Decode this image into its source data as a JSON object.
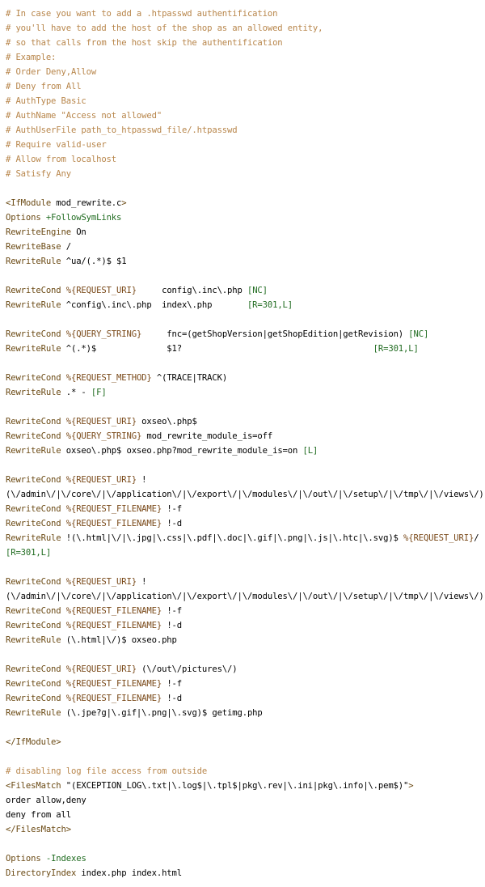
{
  "colors": {
    "comment": "#b8864b",
    "directive": "#6b4a14",
    "option": "#1f6b1f",
    "variable": "#7a4a1a",
    "text": "#000000",
    "background": "#ffffff"
  },
  "lines": [
    [
      [
        "c",
        "# In case you want to add a .htpasswd authentification"
      ]
    ],
    [
      [
        "c",
        "# you'll have to add the host of the shop as an allowed entity,"
      ]
    ],
    [
      [
        "c",
        "# so that calls from the host skip the authentification"
      ]
    ],
    [
      [
        "c",
        "# Example:"
      ]
    ],
    [
      [
        "c",
        "# Order Deny,Allow"
      ]
    ],
    [
      [
        "c",
        "# Deny from All"
      ]
    ],
    [
      [
        "c",
        "# AuthType Basic"
      ]
    ],
    [
      [
        "c",
        "# AuthName \"Access not allowed\""
      ]
    ],
    [
      [
        "c",
        "# AuthUserFile path_to_htpasswd_file/.htpasswd"
      ]
    ],
    [
      [
        "c",
        "# Require valid-user"
      ]
    ],
    [
      [
        "c",
        "# Allow from localhost"
      ]
    ],
    [
      [
        "c",
        "# Satisfy Any"
      ]
    ],
    [],
    [
      [
        "t",
        "<IfModule"
      ],
      [
        "p",
        " mod_rewrite.c"
      ],
      [
        "t",
        ">"
      ]
    ],
    [
      [
        "t",
        "Options"
      ],
      [
        "p",
        " "
      ],
      [
        "g",
        "+FollowSymLinks"
      ]
    ],
    [
      [
        "t",
        "RewriteEngine"
      ],
      [
        "p",
        " On"
      ]
    ],
    [
      [
        "t",
        "RewriteBase"
      ],
      [
        "p",
        " /"
      ]
    ],
    [
      [
        "t",
        "RewriteRule"
      ],
      [
        "p",
        " ^ua/(.*)$ $1"
      ]
    ],
    [],
    [
      [
        "t",
        "RewriteCond"
      ],
      [
        "p",
        " "
      ],
      [
        "v",
        "%{REQUEST_URI}"
      ],
      [
        "p",
        "     config\\.inc\\.php "
      ],
      [
        "g",
        "[NC]"
      ]
    ],
    [
      [
        "t",
        "RewriteRule"
      ],
      [
        "p",
        " ^config\\.inc\\.php  index\\.php       "
      ],
      [
        "g",
        "[R=301,L]"
      ]
    ],
    [],
    [
      [
        "t",
        "RewriteCond"
      ],
      [
        "p",
        " "
      ],
      [
        "v",
        "%{QUERY_STRING}"
      ],
      [
        "p",
        "     fnc=(getShopVersion|getShopEdition|getRevision) "
      ],
      [
        "g",
        "[NC]"
      ]
    ],
    [
      [
        "t",
        "RewriteRule"
      ],
      [
        "p",
        " ^(.*)$              $1?                                      "
      ],
      [
        "g",
        "[R=301,L]"
      ]
    ],
    [],
    [
      [
        "t",
        "RewriteCond"
      ],
      [
        "p",
        " "
      ],
      [
        "v",
        "%{REQUEST_METHOD}"
      ],
      [
        "p",
        " ^(TRACE|TRACK)"
      ]
    ],
    [
      [
        "t",
        "RewriteRule"
      ],
      [
        "p",
        " .* - "
      ],
      [
        "g",
        "[F]"
      ]
    ],
    [],
    [
      [
        "t",
        "RewriteCond"
      ],
      [
        "p",
        " "
      ],
      [
        "v",
        "%{REQUEST_URI}"
      ],
      [
        "p",
        " oxseo\\.php$"
      ]
    ],
    [
      [
        "t",
        "RewriteCond"
      ],
      [
        "p",
        " "
      ],
      [
        "v",
        "%{QUERY_STRING}"
      ],
      [
        "p",
        " mod_rewrite_module_is=off"
      ]
    ],
    [
      [
        "t",
        "RewriteRule"
      ],
      [
        "p",
        " oxseo\\.php$ oxseo.php?mod_rewrite_module_is=on "
      ],
      [
        "g",
        "[L]"
      ]
    ],
    [],
    [
      [
        "t",
        "RewriteCond"
      ],
      [
        "p",
        " "
      ],
      [
        "v",
        "%{REQUEST_URI}"
      ],
      [
        "p",
        " !"
      ]
    ],
    [
      [
        "p",
        "(\\/admin\\/|\\/core\\/|\\/application\\/|\\/export\\/|\\/modules\\/|\\/out\\/|\\/setup\\/|\\/tmp\\/|\\/views\\/)"
      ]
    ],
    [
      [
        "t",
        "RewriteCond"
      ],
      [
        "p",
        " "
      ],
      [
        "v",
        "%{REQUEST_FILENAME}"
      ],
      [
        "p",
        " !-f"
      ]
    ],
    [
      [
        "t",
        "RewriteCond"
      ],
      [
        "p",
        " "
      ],
      [
        "v",
        "%{REQUEST_FILENAME}"
      ],
      [
        "p",
        " !-d"
      ]
    ],
    [
      [
        "t",
        "RewriteRule"
      ],
      [
        "p",
        " !(\\.html|\\/|\\.jpg|\\.css|\\.pdf|\\.doc|\\.gif|\\.png|\\.js|\\.htc|\\.svg)$ "
      ],
      [
        "v",
        "%{REQUEST_URI}"
      ],
      [
        "p",
        "/"
      ]
    ],
    [
      [
        "g",
        "[R=301,L]"
      ]
    ],
    [],
    [
      [
        "t",
        "RewriteCond"
      ],
      [
        "p",
        " "
      ],
      [
        "v",
        "%{REQUEST_URI}"
      ],
      [
        "p",
        " !"
      ]
    ],
    [
      [
        "p",
        "(\\/admin\\/|\\/core\\/|\\/application\\/|\\/export\\/|\\/modules\\/|\\/out\\/|\\/setup\\/|\\/tmp\\/|\\/views\\/)"
      ]
    ],
    [
      [
        "t",
        "RewriteCond"
      ],
      [
        "p",
        " "
      ],
      [
        "v",
        "%{REQUEST_FILENAME}"
      ],
      [
        "p",
        " !-f"
      ]
    ],
    [
      [
        "t",
        "RewriteCond"
      ],
      [
        "p",
        " "
      ],
      [
        "v",
        "%{REQUEST_FILENAME}"
      ],
      [
        "p",
        " !-d"
      ]
    ],
    [
      [
        "t",
        "RewriteRule"
      ],
      [
        "p",
        " (\\.html|\\/)$ oxseo.php"
      ]
    ],
    [],
    [
      [
        "t",
        "RewriteCond"
      ],
      [
        "p",
        " "
      ],
      [
        "v",
        "%{REQUEST_URI}"
      ],
      [
        "p",
        " (\\/out\\/pictures\\/)"
      ]
    ],
    [
      [
        "t",
        "RewriteCond"
      ],
      [
        "p",
        " "
      ],
      [
        "v",
        "%{REQUEST_FILENAME}"
      ],
      [
        "p",
        " !-f"
      ]
    ],
    [
      [
        "t",
        "RewriteCond"
      ],
      [
        "p",
        " "
      ],
      [
        "v",
        "%{REQUEST_FILENAME}"
      ],
      [
        "p",
        " !-d"
      ]
    ],
    [
      [
        "t",
        "RewriteRule"
      ],
      [
        "p",
        " (\\.jpe?g|\\.gif|\\.png|\\.svg)$ getimg.php"
      ]
    ],
    [],
    [
      [
        "t",
        "</IfModule>"
      ]
    ],
    [],
    [
      [
        "c",
        "# disabling log file access from outside"
      ]
    ],
    [
      [
        "t",
        "<FilesMatch"
      ],
      [
        "p",
        " \"(EXCEPTION_LOG\\.txt|\\.log$|\\.tpl$|pkg\\.rev|\\.ini|pkg\\.info|\\.pem$)\""
      ],
      [
        "t",
        ">"
      ]
    ],
    [
      [
        "p",
        "order allow,deny"
      ]
    ],
    [
      [
        "p",
        "deny from all"
      ]
    ],
    [
      [
        "t",
        "</FilesMatch>"
      ]
    ],
    [],
    [
      [
        "t",
        "Options"
      ],
      [
        "p",
        " "
      ],
      [
        "g",
        "-Indexes"
      ]
    ],
    [
      [
        "t",
        "DirectoryIndex"
      ],
      [
        "p",
        " index.php index.html"
      ]
    ]
  ]
}
